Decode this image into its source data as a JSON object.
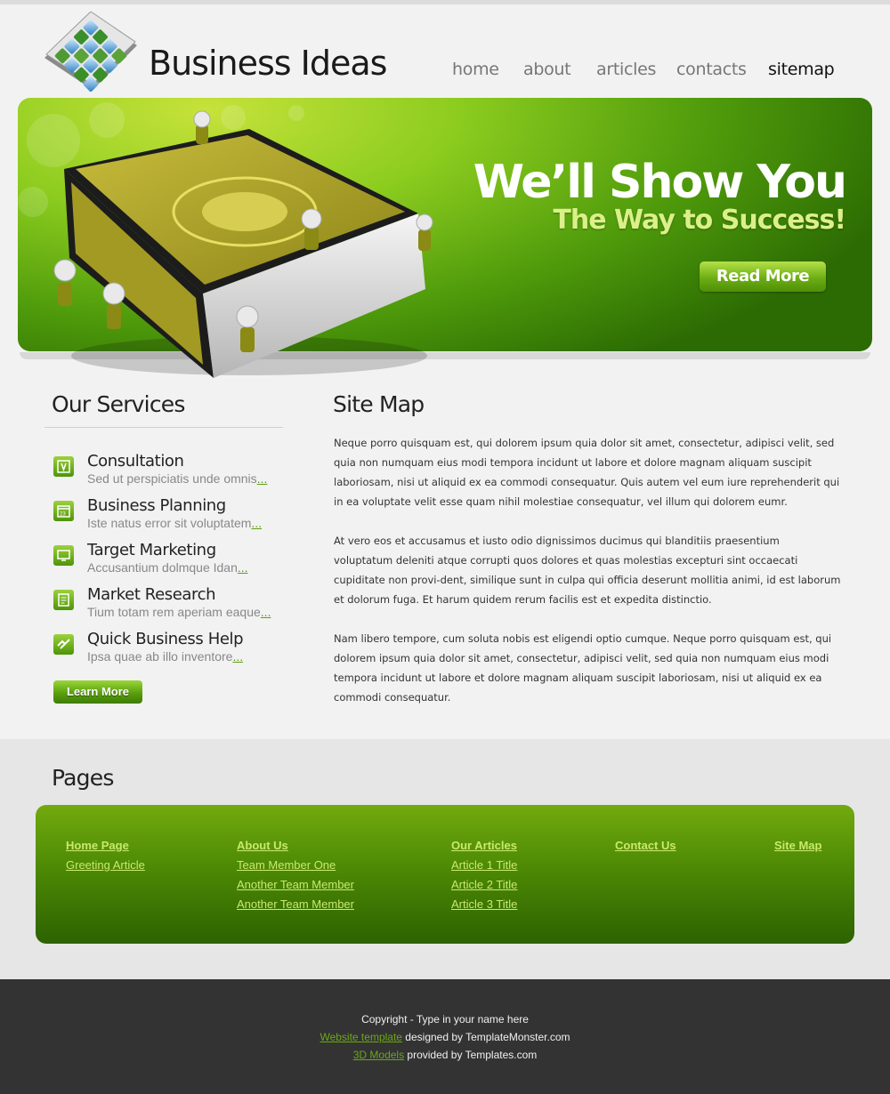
{
  "brand": {
    "name": "Business Ideas"
  },
  "nav": [
    {
      "label": "home"
    },
    {
      "label": "about"
    },
    {
      "label": "articles"
    },
    {
      "label": "contacts"
    },
    {
      "label": "sitemap",
      "active": true
    }
  ],
  "banner": {
    "headline": "We’ll Show You",
    "subhead": "The Way to Success!",
    "button": "Read More"
  },
  "services": {
    "title": "Our Services",
    "items": [
      {
        "title": "Consultation",
        "desc": "Sed ut perspiciatis unde omnis",
        "more": "..."
      },
      {
        "title": "Business Planning",
        "desc": "Iste natus error sit voluptatem",
        "more": "..."
      },
      {
        "title": "Target Marketing",
        "desc": "Accusantium dolmque Idan",
        "more": "..."
      },
      {
        "title": "Market Research",
        "desc": "Tium totam rem aperiam eaque",
        "more": "..."
      },
      {
        "title": "Quick Business Help",
        "desc": "Ipsa quae ab illo inventore",
        "more": "..."
      }
    ],
    "button": "Learn More"
  },
  "sitemap": {
    "title": "Site Map",
    "paragraphs": [
      "Neque porro quisquam est, qui dolorem ipsum quia dolor sit amet, consectetur, adipisci velit, sed quia non numquam eius modi tempora incidunt ut labore et dolore magnam aliquam suscipit laboriosam, nisi ut aliquid ex ea commodi consequatur. Quis autem vel eum iure reprehenderit qui in ea voluptate velit esse quam nihil molestiae consequatur, vel illum qui dolorem eumr.",
      "At vero eos et accusamus et iusto odio dignissimos ducimus qui blanditiis praesentium voluptatum deleniti atque corrupti quos dolores et quas molestias excepturi sint occaecati cupiditate non provi-dent, similique sunt in culpa qui officia deserunt mollitia animi, id est laborum et dolorum fuga. Et harum quidem rerum facilis est et expedita distinctio.",
      "Nam libero tempore, cum soluta nobis est eligendi optio cumque. Neque porro quisquam est, qui dolorem ipsum quia dolor sit amet, consectetur, adipisci velit, sed quia non numquam eius modi tempora incidunt ut labore et dolore magnam aliquam suscipit laboriosam, nisi ut aliquid ex ea commodi consequatur."
    ]
  },
  "pages": {
    "title": "Pages",
    "columns": [
      {
        "head": "Home Page",
        "links": [
          "Greeting Article"
        ]
      },
      {
        "head": "About Us",
        "links": [
          "Team Member One",
          "Another Team Member",
          "Another Team Member"
        ]
      },
      {
        "head": "Our Articles",
        "links": [
          "Article 1 Title",
          "Article 2 Title",
          "Article 3 Title"
        ]
      },
      {
        "head": "Contact Us",
        "links": []
      },
      {
        "head": "Site Map",
        "links": []
      }
    ]
  },
  "footer": {
    "copyright": "Copyright - Type in your name here",
    "line2_link": "Website template",
    "line2_text": " designed by TemplateMonster.com",
    "line3_link": "3D Models",
    "line3_text": " provided by Templates.com"
  },
  "colors": {
    "accent_green": "#5e9e12",
    "link_green": "#c9e96e",
    "footer_bg": "#333333"
  }
}
